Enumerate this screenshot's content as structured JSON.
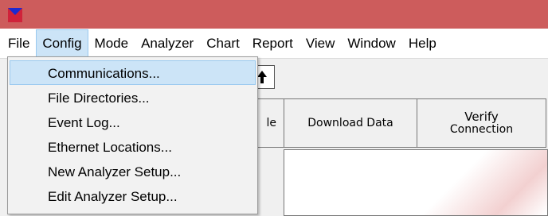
{
  "window": {
    "titlebar_color": "#cd5c5c",
    "icon": "app-logo-icon"
  },
  "menubar": {
    "items": [
      "File",
      "Config",
      "Mode",
      "Analyzer",
      "Chart",
      "Report",
      "View",
      "Window",
      "Help"
    ],
    "open_item": "Config"
  },
  "toolbar": {
    "arrow_button_icon": "up-arrow-icon",
    "arrow_glyph": "🠙",
    "partial_button_label": "le",
    "download_label": "Download Data",
    "verify_line1": "Verify",
    "verify_line2": "Connection"
  },
  "config_menu": {
    "items": [
      "Communications...",
      "File Directories...",
      "Event Log...",
      "Ethernet Locations...",
      "New Analyzer Setup...",
      "Edit Analyzer Setup..."
    ],
    "highlighted": "Communications..."
  },
  "colors": {
    "menu_highlight": "#cce4f7",
    "menu_highlight_border": "#99c9ef"
  }
}
